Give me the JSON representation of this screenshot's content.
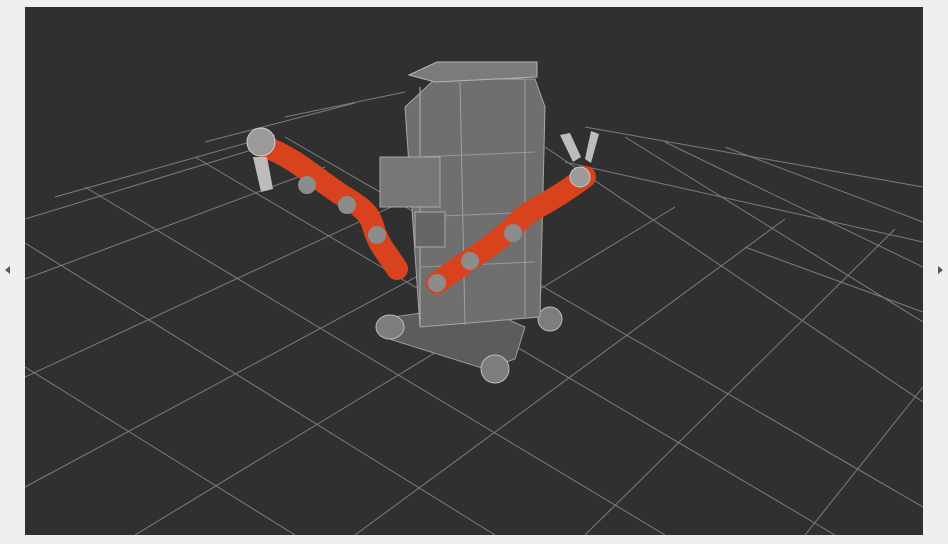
{
  "viewer": {
    "background": "#303030",
    "grid_color": "#8a8a8a",
    "arm_color": "#d8431e",
    "joint_color": "#8c8c8c",
    "frame_color": "#6f6f6f"
  },
  "controls": {
    "collapse_left_icon": "triangle-left",
    "collapse_right_icon": "triangle-right"
  }
}
